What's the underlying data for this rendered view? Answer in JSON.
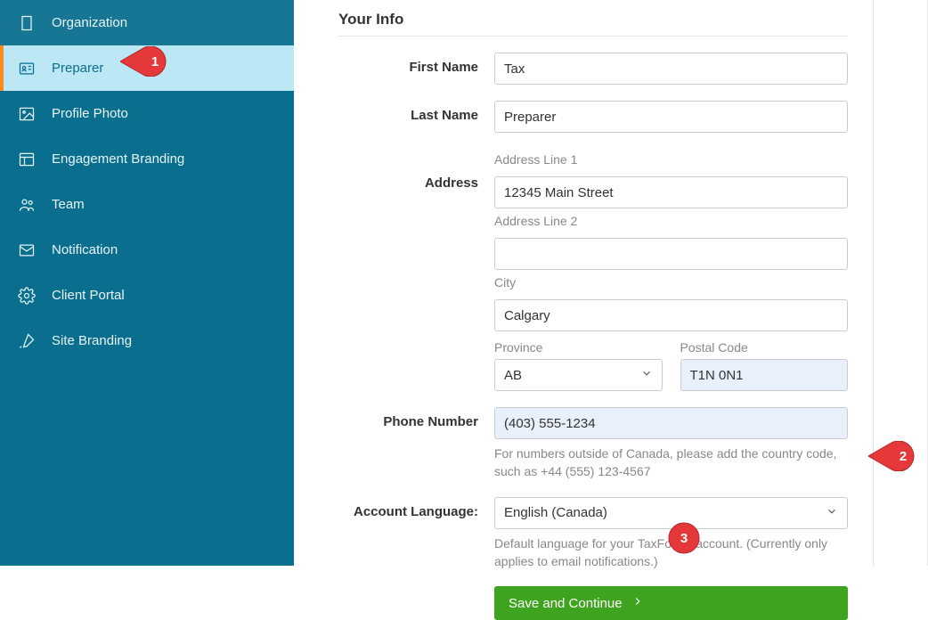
{
  "sidebar": {
    "items": [
      {
        "label": "Organization"
      },
      {
        "label": "Preparer"
      },
      {
        "label": "Profile Photo"
      },
      {
        "label": "Engagement Branding"
      },
      {
        "label": "Team"
      },
      {
        "label": "Notification"
      },
      {
        "label": "Client Portal"
      },
      {
        "label": "Site Branding"
      }
    ]
  },
  "section_title": "Your Info",
  "form": {
    "first_name": {
      "label": "First Name",
      "value": "Tax"
    },
    "last_name": {
      "label": "Last Name",
      "value": "Preparer"
    },
    "address": {
      "label": "Address",
      "line1_label": "Address Line 1",
      "line1_value": "12345 Main Street",
      "line2_label": "Address Line 2",
      "line2_value": "",
      "city_label": "City",
      "city_value": "Calgary",
      "province_label": "Province",
      "province_value": "AB",
      "postal_label": "Postal Code",
      "postal_value": "T1N 0N1"
    },
    "phone": {
      "label": "Phone Number",
      "value": "(403) 555-1234",
      "help": "For numbers outside of Canada, please add the country code, such as +44 (555) 123-4567"
    },
    "language": {
      "label": "Account Language:",
      "value": "English (Canada)",
      "help": "Default language for your TaxFolder account. (Currently only applies to email notifications.)"
    },
    "save_label": "Save and Continue"
  },
  "callouts": {
    "c1": "1",
    "c2": "2",
    "c3": "3"
  }
}
